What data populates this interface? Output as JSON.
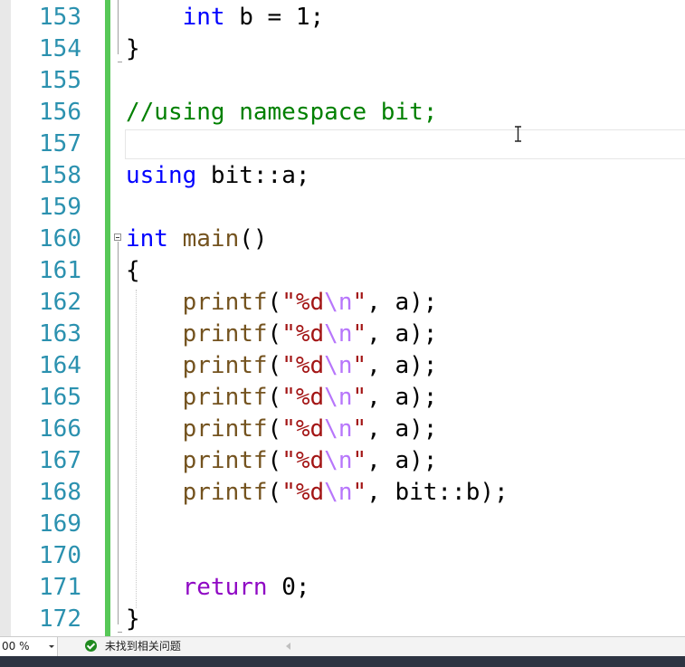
{
  "lines": [
    {
      "num": "153",
      "tokens": [
        {
          "t": "    ",
          "c": ""
        },
        {
          "t": "int",
          "c": "kw"
        },
        {
          "t": " b = 1;",
          "c": ""
        }
      ]
    },
    {
      "num": "154",
      "tokens": [
        {
          "t": "}",
          "c": ""
        }
      ]
    },
    {
      "num": "155",
      "tokens": []
    },
    {
      "num": "156",
      "tokens": [
        {
          "t": "//using namespace bit;",
          "c": "cm"
        }
      ]
    },
    {
      "num": "157",
      "tokens": []
    },
    {
      "num": "158",
      "tokens": [
        {
          "t": "using",
          "c": "kw"
        },
        {
          "t": " bit::a;",
          "c": ""
        }
      ]
    },
    {
      "num": "159",
      "tokens": []
    },
    {
      "num": "160",
      "tokens": [
        {
          "t": "int",
          "c": "kw"
        },
        {
          "t": " ",
          "c": ""
        },
        {
          "t": "main",
          "c": "fn"
        },
        {
          "t": "()",
          "c": ""
        }
      ]
    },
    {
      "num": "161",
      "tokens": [
        {
          "t": "{",
          "c": ""
        }
      ]
    },
    {
      "num": "162",
      "tokens": [
        {
          "t": "    ",
          "c": ""
        },
        {
          "t": "printf",
          "c": "fn"
        },
        {
          "t": "(",
          "c": ""
        },
        {
          "t": "\"%d",
          "c": "str"
        },
        {
          "t": "\\n",
          "c": "esc"
        },
        {
          "t": "\"",
          "c": "str"
        },
        {
          "t": ", a);",
          "c": ""
        }
      ]
    },
    {
      "num": "163",
      "tokens": [
        {
          "t": "    ",
          "c": ""
        },
        {
          "t": "printf",
          "c": "fn"
        },
        {
          "t": "(",
          "c": ""
        },
        {
          "t": "\"%d",
          "c": "str"
        },
        {
          "t": "\\n",
          "c": "esc"
        },
        {
          "t": "\"",
          "c": "str"
        },
        {
          "t": ", a);",
          "c": ""
        }
      ]
    },
    {
      "num": "164",
      "tokens": [
        {
          "t": "    ",
          "c": ""
        },
        {
          "t": "printf",
          "c": "fn"
        },
        {
          "t": "(",
          "c": ""
        },
        {
          "t": "\"%d",
          "c": "str"
        },
        {
          "t": "\\n",
          "c": "esc"
        },
        {
          "t": "\"",
          "c": "str"
        },
        {
          "t": ", a);",
          "c": ""
        }
      ]
    },
    {
      "num": "165",
      "tokens": [
        {
          "t": "    ",
          "c": ""
        },
        {
          "t": "printf",
          "c": "fn"
        },
        {
          "t": "(",
          "c": ""
        },
        {
          "t": "\"%d",
          "c": "str"
        },
        {
          "t": "\\n",
          "c": "esc"
        },
        {
          "t": "\"",
          "c": "str"
        },
        {
          "t": ", a);",
          "c": ""
        }
      ]
    },
    {
      "num": "166",
      "tokens": [
        {
          "t": "    ",
          "c": ""
        },
        {
          "t": "printf",
          "c": "fn"
        },
        {
          "t": "(",
          "c": ""
        },
        {
          "t": "\"%d",
          "c": "str"
        },
        {
          "t": "\\n",
          "c": "esc"
        },
        {
          "t": "\"",
          "c": "str"
        },
        {
          "t": ", a);",
          "c": ""
        }
      ]
    },
    {
      "num": "167",
      "tokens": [
        {
          "t": "    ",
          "c": ""
        },
        {
          "t": "printf",
          "c": "fn"
        },
        {
          "t": "(",
          "c": ""
        },
        {
          "t": "\"%d",
          "c": "str"
        },
        {
          "t": "\\n",
          "c": "esc"
        },
        {
          "t": "\"",
          "c": "str"
        },
        {
          "t": ", a);",
          "c": ""
        }
      ]
    },
    {
      "num": "168",
      "tokens": [
        {
          "t": "    ",
          "c": ""
        },
        {
          "t": "printf",
          "c": "fn"
        },
        {
          "t": "(",
          "c": ""
        },
        {
          "t": "\"%d",
          "c": "str"
        },
        {
          "t": "\\n",
          "c": "esc"
        },
        {
          "t": "\"",
          "c": "str"
        },
        {
          "t": ", bit::b);",
          "c": ""
        }
      ]
    },
    {
      "num": "169",
      "tokens": []
    },
    {
      "num": "170",
      "tokens": []
    },
    {
      "num": "171",
      "tokens": [
        {
          "t": "    ",
          "c": ""
        },
        {
          "t": "return",
          "c": "kw2"
        },
        {
          "t": " 0;",
          "c": ""
        }
      ]
    },
    {
      "num": "172",
      "tokens": [
        {
          "t": "}",
          "c": ""
        }
      ]
    }
  ],
  "statusbar": {
    "zoom": "00 %",
    "issues": "未找到相关问题"
  },
  "colors": {
    "line_number": "#2b91af",
    "keyword": "#0000ff",
    "control_keyword": "#8f08c4",
    "comment": "#008000",
    "function": "#74531f",
    "string": "#a31515",
    "escape": "#b776fb",
    "change_bar": "#57c857"
  },
  "icons": {
    "fold": "collapse-minus-icon",
    "status_ok": "check-circle-icon",
    "text_cursor": "ibeam-cursor-icon"
  }
}
